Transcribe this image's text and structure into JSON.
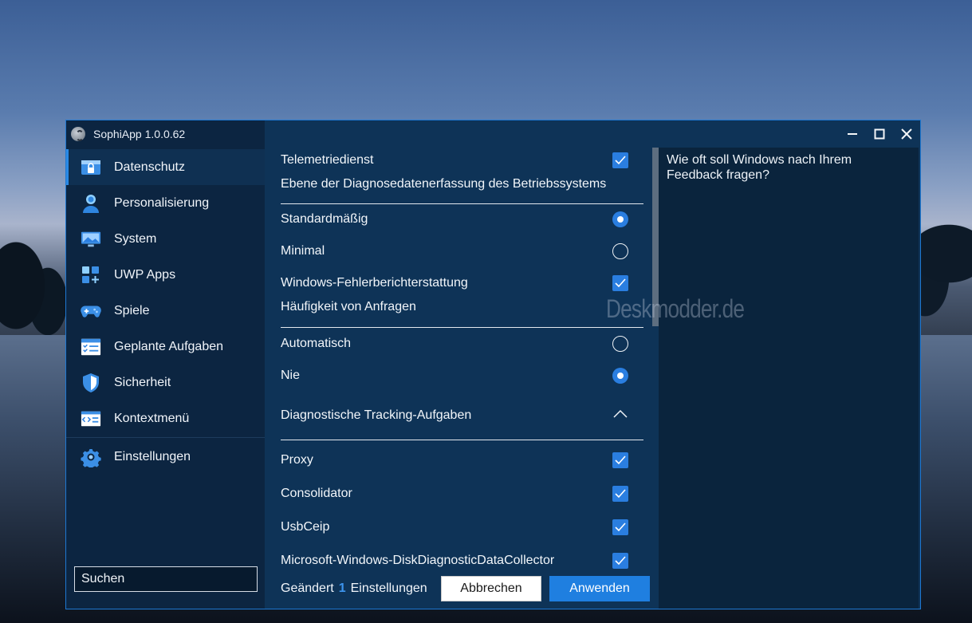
{
  "window": {
    "title": "SophiApp 1.0.0.62"
  },
  "sidebar": {
    "items": [
      {
        "label": "Datenschutz",
        "icon": "privacy-icon"
      },
      {
        "label": "Personalisierung",
        "icon": "person-icon"
      },
      {
        "label": "System",
        "icon": "monitor-icon"
      },
      {
        "label": "UWP Apps",
        "icon": "apps-icon"
      },
      {
        "label": "Spiele",
        "icon": "gamepad-icon"
      },
      {
        "label": "Geplante Aufgaben",
        "icon": "task-list-icon"
      },
      {
        "label": "Sicherheit",
        "icon": "shield-icon"
      },
      {
        "label": "Kontextmenü",
        "icon": "context-menu-icon"
      },
      {
        "label": "Einstellungen",
        "icon": "gear-icon"
      }
    ],
    "search_value": "Suchen"
  },
  "settings": {
    "telemetry": "Telemetriedienst",
    "diag_level_heading": "Ebene der Diagnosedatenerfassung des Betriebssystems",
    "standard": "Standardmäßig",
    "minimal": "Minimal",
    "error_reporting": "Windows-Fehlerberichterstattung",
    "frequency_heading": "Häufigkeit von Anfragen",
    "automatic": "Automatisch",
    "never": "Nie",
    "tracking_tasks": "Diagnostische Tracking-Aufgaben",
    "proxy": "Proxy",
    "consolidator": "Consolidator",
    "usbceip": "UsbCeip",
    "disk_collector": "Microsoft-Windows-DiskDiagnosticDataCollector"
  },
  "description": {
    "text": "Wie oft soll Windows nach Ihrem Feedback fragen?"
  },
  "footer": {
    "changed_prefix": "Geändert",
    "changed_count": "1",
    "changed_suffix": "Einstellungen",
    "cancel_label": "Abbrechen",
    "apply_label": "Anwenden"
  },
  "watermark": "Deskmodder.de",
  "colors": {
    "accent": "#2a7ee0",
    "window_bg": "#0c2a45",
    "sidebar_bg": "#0c2541"
  }
}
